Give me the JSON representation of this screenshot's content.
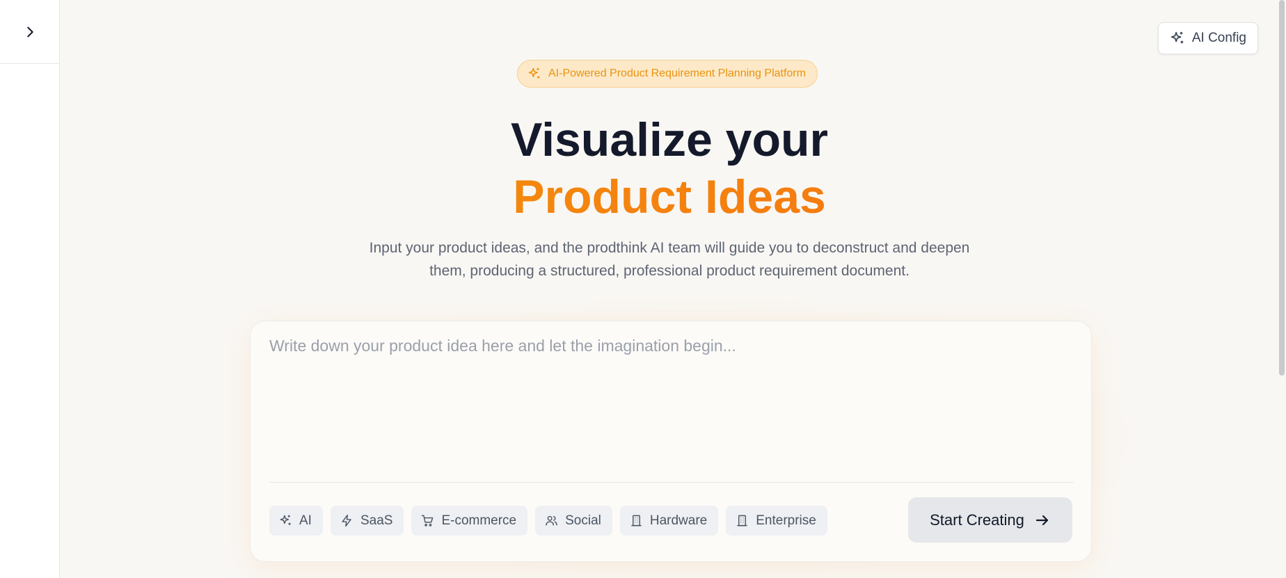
{
  "sidebar": {
    "expand_icon": "chevron-right-icon"
  },
  "header": {
    "config_label": "AI Config",
    "config_icon": "sparkles-icon"
  },
  "hero": {
    "badge_text": "AI-Powered Product Requirement Planning Platform",
    "badge_icon": "sparkles-icon",
    "title_line1": "Visualize your",
    "title_line2": "Product Ideas",
    "subtitle_line1": "Input your product ideas, and the prodthink AI team will guide you to deconstruct and deepen",
    "subtitle_line2": "them, producing a structured, professional product requirement document."
  },
  "composer": {
    "placeholder": "Write down your product idea here and let the imagination begin...",
    "value": "",
    "tags": [
      {
        "label": "AI",
        "icon": "sparkles-icon"
      },
      {
        "label": "SaaS",
        "icon": "zap-icon"
      },
      {
        "label": "E-commerce",
        "icon": "shopping-cart-icon"
      },
      {
        "label": "Social",
        "icon": "users-icon"
      },
      {
        "label": "Hardware",
        "icon": "building-icon"
      },
      {
        "label": "Enterprise",
        "icon": "building-icon"
      }
    ],
    "start_label": "Start Creating",
    "start_icon": "arrow-right-icon"
  },
  "colors": {
    "accent": "#f3980c",
    "accent_end": "#f56c12",
    "title_dark": "#141a2b",
    "background": "#f9f7f4"
  }
}
